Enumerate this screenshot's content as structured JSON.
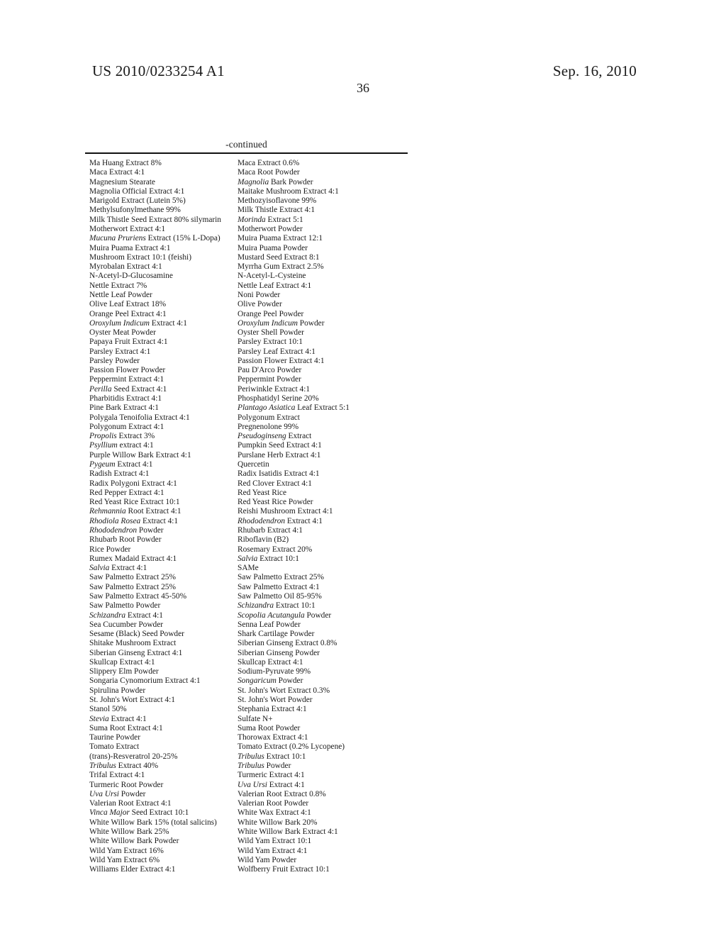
{
  "header": {
    "publication_number": "US 2010/0233254 A1",
    "publication_date": "Sep. 16, 2010",
    "page_number": "36"
  },
  "table": {
    "continued_label": "-continued",
    "rows": [
      [
        "Ma Huang Extract 8%",
        "Maca Extract 0.6%"
      ],
      [
        "Maca Extract 4:1",
        "Maca Root Powder"
      ],
      [
        "Magnesium Stearate",
        "Magnolia Bark Powder"
      ],
      [
        "Magnolia Official Extract 4:1",
        "Maitake Mushroom Extract 4:1"
      ],
      [
        "Marigold Extract (Lutein 5%)",
        "Methozyisoflavone 99%"
      ],
      [
        "Methylsufonylmethane 99%",
        "Milk Thistle Extract 4:1"
      ],
      [
        "Milk Thistle Seed Extract 80% silymarin",
        "Morinda Extract 5:1"
      ],
      [
        "Motherwort Extract 4:1",
        "Motherwort Powder"
      ],
      [
        "Mucuna Pruriens Extract (15% L-Dopa)",
        "Muira Puama Extract 12:1"
      ],
      [
        "Muira Puama Extract 4:1",
        "Muira Puama Powder"
      ],
      [
        "Mushroom Extract 10:1 (feishi)",
        "Mustard Seed Extract 8:1"
      ],
      [
        "Myrobalan Extract 4:1",
        "Myrrha Gum Extract 2.5%"
      ],
      [
        "N-Acetyl-D-Glucosamine",
        "N-Acetyl-L-Cysteine"
      ],
      [
        "Nettle Extract 7%",
        "Nettle Leaf Extract 4:1"
      ],
      [
        "Nettle Leaf Powder",
        "Noni Powder"
      ],
      [
        "Olive Leaf Extract 18%",
        "Olive Powder"
      ],
      [
        "Orange Peel Extract 4:1",
        "Orange Peel Powder"
      ],
      [
        "Oroxylum Indicum Extract 4:1",
        "Oroxylum Indicum Powder"
      ],
      [
        "Oyster Meat Powder",
        "Oyster Shell Powder"
      ],
      [
        "Papaya Fruit Extract 4:1",
        "Parsley Extract 10:1"
      ],
      [
        "Parsley Extract 4:1",
        "Parsley Leaf Extract 4:1"
      ],
      [
        "Parsley Powder",
        "Passion Flower Extract 4:1"
      ],
      [
        "Passion Flower Powder",
        "Pau D'Arco Powder"
      ],
      [
        "Peppermint Extract 4:1",
        "Peppermint Powder"
      ],
      [
        "Perilla Seed Extract 4:1",
        "Periwinkle Extract 4:1"
      ],
      [
        "Pharbitidis Extract 4:1",
        "Phosphatidyl Serine 20%"
      ],
      [
        "Pine Bark Extract 4:1",
        "Plantago Asiatica Leaf Extract 5:1"
      ],
      [
        "Polygala Tenoifolia Extract 4:1",
        "Polygonum Extract"
      ],
      [
        "Polygonum Extract 4:1",
        "Pregnenolone 99%"
      ],
      [
        "Propolis Extract 3%",
        "Pseudoginseng Extract"
      ],
      [
        "Psyllium extract 4:1",
        "Pumpkin Seed Extract 4:1"
      ],
      [
        "Purple Willow Bark Extract 4:1",
        "Purslane Herb Extract 4:1"
      ],
      [
        "Pygeum Extract 4:1",
        "Quercetin"
      ],
      [
        "Radish Extract 4:1",
        "Radix Isatidis Extract 4:1"
      ],
      [
        "Radix Polygoni Extract 4:1",
        "Red Clover Extract 4:1"
      ],
      [
        "Red Pepper Extract 4:1",
        "Red Yeast Rice"
      ],
      [
        "Red Yeast Rice Extract 10:1",
        "Red Yeast Rice Powder"
      ],
      [
        "Rehmannia Root Extract 4:1",
        "Reishi Mushroom Extract 4:1"
      ],
      [
        "Rhodiola Rosea Extract 4:1",
        "Rhododendron Extract 4:1"
      ],
      [
        "Rhododendron Powder",
        "Rhubarb Extract 4:1"
      ],
      [
        "Rhubarb Root Powder",
        "Riboflavin (B2)"
      ],
      [
        "Rice Powder",
        "Rosemary Extract 20%"
      ],
      [
        "Rumex Madaid Extract 4:1",
        "Salvia Extract 10:1"
      ],
      [
        "Salvia Extract 4:1",
        "SAMe"
      ],
      [
        "Saw Palmetto Extract 25%",
        "Saw Palmetto Extract 25%"
      ],
      [
        "Saw Palmetto Extract 25%",
        "Saw Palmetto Extract 4:1"
      ],
      [
        "Saw Palmetto Extract 45-50%",
        "Saw Palmetto Oil 85-95%"
      ],
      [
        "Saw Palmetto Powder",
        "Schizandra Extract 10:1"
      ],
      [
        "Schizandra Extract 4:1",
        "Scopolia Acutangula Powder"
      ],
      [
        "Sea Cucumber Powder",
        "Senna Leaf Powder"
      ],
      [
        "Sesame (Black) Seed Powder",
        "Shark Cartilage Powder"
      ],
      [
        "Shitake Mushroom Extract",
        "Siberian Ginseng Extract 0.8%"
      ],
      [
        "Siberian Ginseng Extract 4:1",
        "Siberian Ginseng Powder"
      ],
      [
        "Skullcap Extract 4:1",
        "Skullcap Extract 4:1"
      ],
      [
        "Slippery Elm Powder",
        "Sodium-Pyruvate 99%"
      ],
      [
        "Songaria Cynomorium Extract 4:1",
        "Songaricum Powder"
      ],
      [
        "Spirulina Powder",
        "St. John's Wort Extract 0.3%"
      ],
      [
        "St. John's Wort Extract 4:1",
        "St. John's Wort Powder"
      ],
      [
        "Stanol 50%",
        "Stephania Extract 4:1"
      ],
      [
        "Stevia Extract 4:1",
        "Sulfate N+"
      ],
      [
        "Suma Root Extract 4:1",
        "Suma Root Powder"
      ],
      [
        "Taurine Powder",
        "Thorowax Extract 4:1"
      ],
      [
        "Tomato Extract",
        "Tomato Extract (0.2% Lycopene)"
      ],
      [
        "(trans)-Resveratrol 20-25%",
        "Tribulus Extract 10:1"
      ],
      [
        "Tribulus Extract 40%",
        "Tribulus Powder"
      ],
      [
        "Trifal Extract 4:1",
        "Turmeric Extract 4:1"
      ],
      [
        "Turmeric Root Powder",
        "Uva Ursi Extract 4:1"
      ],
      [
        "Uva Ursi Powder",
        "Valerian Root Extract 0.8%"
      ],
      [
        "Valerian Root Extract 4:1",
        "Valerian Root Powder"
      ],
      [
        "Vinca Major Seed Extract 10:1",
        "White Wax Extract 4:1"
      ],
      [
        "White Willow Bark 15% (total salicins)",
        "White Willow Bark 20%"
      ],
      [
        "White Willow Bark 25%",
        "White Willow Bark Extract 4:1"
      ],
      [
        "White Willow Bark Powder",
        "Wild Yam Extract 10:1"
      ],
      [
        "Wild Yam Extract 16%",
        "Wild Yam Extract 4:1"
      ],
      [
        "Wild Yam Extract 6%",
        "Wild Yam Powder"
      ],
      [
        "Williams Elder Extract 4:1",
        "Wolfberry Fruit Extract 10:1"
      ]
    ],
    "italic_prefixes": {
      "Magnolia Bark Powder": 1,
      "Morinda Extract 5:1": 1,
      "Mucuna Pruriens Extract (15% L-Dopa)": 2,
      "Oroxylum Indicum Extract 4:1": 2,
      "Oroxylum Indicum Powder": 2,
      "Perilla Seed Extract 4:1": 1,
      "Plantago Asiatica Leaf Extract 5:1": 2,
      "Propolis Extract 3%": 1,
      "Pseudoginseng Extract": 1,
      "Psyllium extract 4:1": 1,
      "Pygeum Extract 4:1": 1,
      "Rehmannia Root Extract 4:1": 1,
      "Rhodiola Rosea Extract 4:1": 2,
      "Rhododendron Extract 4:1": 1,
      "Rhododendron Powder": 1,
      "Salvia Extract 10:1": 1,
      "Salvia Extract 4:1": 1,
      "Schizandra Extract 10:1": 1,
      "Schizandra Extract 4:1": 1,
      "Scopolia Acutangula Powder": 2,
      "Songaricum Powder": 1,
      "Stevia Extract 4:1": 1,
      "Tribulus Extract 10:1": 1,
      "Tribulus Extract 40%": 1,
      "Tribulus Powder": 1,
      "Uva Ursi Extract 4:1": 2,
      "Uva Ursi Powder": 2,
      "Vinca Major Seed Extract 10:1": 2
    }
  }
}
